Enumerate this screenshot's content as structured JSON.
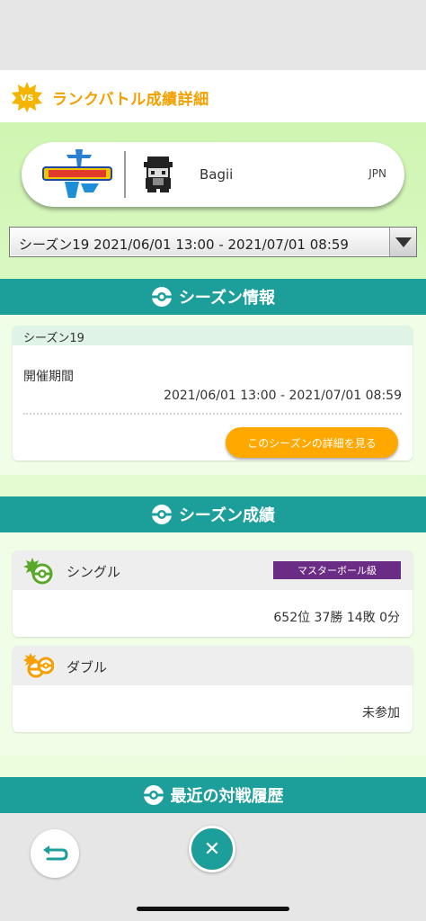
{
  "header": {
    "title": "ランクバトル成績詳細",
    "badge_text": "VS"
  },
  "trainer": {
    "name": "Bagii",
    "country": "JPN"
  },
  "season_select": {
    "selected": "シーズン19 2021/06/01 13:00 - 2021/07/01 08:59"
  },
  "season_info": {
    "title": "シーズン情報",
    "season_label": "シーズン19",
    "period_label": "開催期間",
    "period_value": "2021/06/01 13:00 - 2021/07/01 08:59",
    "detail_button": "このシーズンの詳細を見る"
  },
  "season_results": {
    "title": "シーズン成績",
    "single": {
      "label": "シングル",
      "rank_badge": "マスターボール級",
      "value": "652位 37勝 14敗 0分"
    },
    "double": {
      "label": "ダブル",
      "value": "未参加"
    }
  },
  "recent_battles": {
    "title": "最近の対戦履歴"
  },
  "colors": {
    "accent_teal": "#1c9e9a",
    "accent_orange": "#ffa800",
    "title_orange": "#f2a000",
    "rank_purple": "#6b2c86"
  },
  "icons": {
    "back": "back-arrow-icon",
    "close": "close-icon",
    "section": "pokeball-icon"
  }
}
